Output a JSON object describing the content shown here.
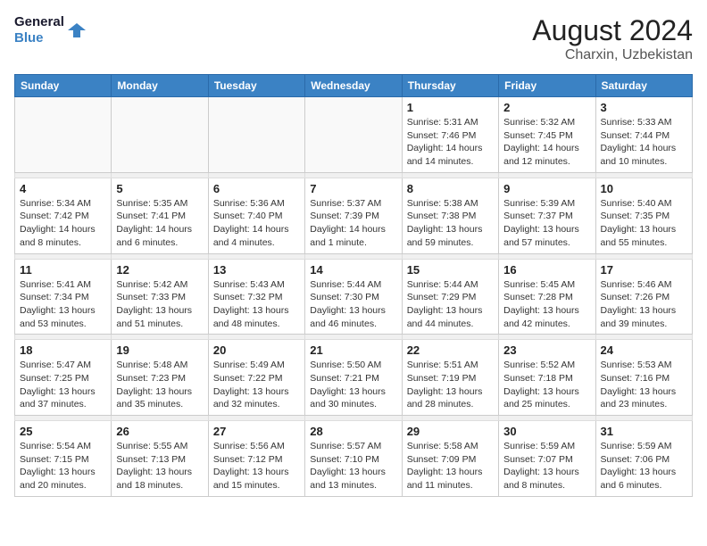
{
  "header": {
    "logo_line1": "General",
    "logo_line2": "Blue",
    "month_year": "August 2024",
    "location": "Charxin, Uzbekistan"
  },
  "days_of_week": [
    "Sunday",
    "Monday",
    "Tuesday",
    "Wednesday",
    "Thursday",
    "Friday",
    "Saturday"
  ],
  "weeks": [
    [
      {
        "num": "",
        "sunrise": "",
        "sunset": "",
        "daylight": ""
      },
      {
        "num": "",
        "sunrise": "",
        "sunset": "",
        "daylight": ""
      },
      {
        "num": "",
        "sunrise": "",
        "sunset": "",
        "daylight": ""
      },
      {
        "num": "",
        "sunrise": "",
        "sunset": "",
        "daylight": ""
      },
      {
        "num": "1",
        "sunrise": "Sunrise: 5:31 AM",
        "sunset": "Sunset: 7:46 PM",
        "daylight": "Daylight: 14 hours and 14 minutes."
      },
      {
        "num": "2",
        "sunrise": "Sunrise: 5:32 AM",
        "sunset": "Sunset: 7:45 PM",
        "daylight": "Daylight: 14 hours and 12 minutes."
      },
      {
        "num": "3",
        "sunrise": "Sunrise: 5:33 AM",
        "sunset": "Sunset: 7:44 PM",
        "daylight": "Daylight: 14 hours and 10 minutes."
      }
    ],
    [
      {
        "num": "4",
        "sunrise": "Sunrise: 5:34 AM",
        "sunset": "Sunset: 7:42 PM",
        "daylight": "Daylight: 14 hours and 8 minutes."
      },
      {
        "num": "5",
        "sunrise": "Sunrise: 5:35 AM",
        "sunset": "Sunset: 7:41 PM",
        "daylight": "Daylight: 14 hours and 6 minutes."
      },
      {
        "num": "6",
        "sunrise": "Sunrise: 5:36 AM",
        "sunset": "Sunset: 7:40 PM",
        "daylight": "Daylight: 14 hours and 4 minutes."
      },
      {
        "num": "7",
        "sunrise": "Sunrise: 5:37 AM",
        "sunset": "Sunset: 7:39 PM",
        "daylight": "Daylight: 14 hours and 1 minute."
      },
      {
        "num": "8",
        "sunrise": "Sunrise: 5:38 AM",
        "sunset": "Sunset: 7:38 PM",
        "daylight": "Daylight: 13 hours and 59 minutes."
      },
      {
        "num": "9",
        "sunrise": "Sunrise: 5:39 AM",
        "sunset": "Sunset: 7:37 PM",
        "daylight": "Daylight: 13 hours and 57 minutes."
      },
      {
        "num": "10",
        "sunrise": "Sunrise: 5:40 AM",
        "sunset": "Sunset: 7:35 PM",
        "daylight": "Daylight: 13 hours and 55 minutes."
      }
    ],
    [
      {
        "num": "11",
        "sunrise": "Sunrise: 5:41 AM",
        "sunset": "Sunset: 7:34 PM",
        "daylight": "Daylight: 13 hours and 53 minutes."
      },
      {
        "num": "12",
        "sunrise": "Sunrise: 5:42 AM",
        "sunset": "Sunset: 7:33 PM",
        "daylight": "Daylight: 13 hours and 51 minutes."
      },
      {
        "num": "13",
        "sunrise": "Sunrise: 5:43 AM",
        "sunset": "Sunset: 7:32 PM",
        "daylight": "Daylight: 13 hours and 48 minutes."
      },
      {
        "num": "14",
        "sunrise": "Sunrise: 5:44 AM",
        "sunset": "Sunset: 7:30 PM",
        "daylight": "Daylight: 13 hours and 46 minutes."
      },
      {
        "num": "15",
        "sunrise": "Sunrise: 5:44 AM",
        "sunset": "Sunset: 7:29 PM",
        "daylight": "Daylight: 13 hours and 44 minutes."
      },
      {
        "num": "16",
        "sunrise": "Sunrise: 5:45 AM",
        "sunset": "Sunset: 7:28 PM",
        "daylight": "Daylight: 13 hours and 42 minutes."
      },
      {
        "num": "17",
        "sunrise": "Sunrise: 5:46 AM",
        "sunset": "Sunset: 7:26 PM",
        "daylight": "Daylight: 13 hours and 39 minutes."
      }
    ],
    [
      {
        "num": "18",
        "sunrise": "Sunrise: 5:47 AM",
        "sunset": "Sunset: 7:25 PM",
        "daylight": "Daylight: 13 hours and 37 minutes."
      },
      {
        "num": "19",
        "sunrise": "Sunrise: 5:48 AM",
        "sunset": "Sunset: 7:23 PM",
        "daylight": "Daylight: 13 hours and 35 minutes."
      },
      {
        "num": "20",
        "sunrise": "Sunrise: 5:49 AM",
        "sunset": "Sunset: 7:22 PM",
        "daylight": "Daylight: 13 hours and 32 minutes."
      },
      {
        "num": "21",
        "sunrise": "Sunrise: 5:50 AM",
        "sunset": "Sunset: 7:21 PM",
        "daylight": "Daylight: 13 hours and 30 minutes."
      },
      {
        "num": "22",
        "sunrise": "Sunrise: 5:51 AM",
        "sunset": "Sunset: 7:19 PM",
        "daylight": "Daylight: 13 hours and 28 minutes."
      },
      {
        "num": "23",
        "sunrise": "Sunrise: 5:52 AM",
        "sunset": "Sunset: 7:18 PM",
        "daylight": "Daylight: 13 hours and 25 minutes."
      },
      {
        "num": "24",
        "sunrise": "Sunrise: 5:53 AM",
        "sunset": "Sunset: 7:16 PM",
        "daylight": "Daylight: 13 hours and 23 minutes."
      }
    ],
    [
      {
        "num": "25",
        "sunrise": "Sunrise: 5:54 AM",
        "sunset": "Sunset: 7:15 PM",
        "daylight": "Daylight: 13 hours and 20 minutes."
      },
      {
        "num": "26",
        "sunrise": "Sunrise: 5:55 AM",
        "sunset": "Sunset: 7:13 PM",
        "daylight": "Daylight: 13 hours and 18 minutes."
      },
      {
        "num": "27",
        "sunrise": "Sunrise: 5:56 AM",
        "sunset": "Sunset: 7:12 PM",
        "daylight": "Daylight: 13 hours and 15 minutes."
      },
      {
        "num": "28",
        "sunrise": "Sunrise: 5:57 AM",
        "sunset": "Sunset: 7:10 PM",
        "daylight": "Daylight: 13 hours and 13 minutes."
      },
      {
        "num": "29",
        "sunrise": "Sunrise: 5:58 AM",
        "sunset": "Sunset: 7:09 PM",
        "daylight": "Daylight: 13 hours and 11 minutes."
      },
      {
        "num": "30",
        "sunrise": "Sunrise: 5:59 AM",
        "sunset": "Sunset: 7:07 PM",
        "daylight": "Daylight: 13 hours and 8 minutes."
      },
      {
        "num": "31",
        "sunrise": "Sunrise: 5:59 AM",
        "sunset": "Sunset: 7:06 PM",
        "daylight": "Daylight: 13 hours and 6 minutes."
      }
    ]
  ]
}
